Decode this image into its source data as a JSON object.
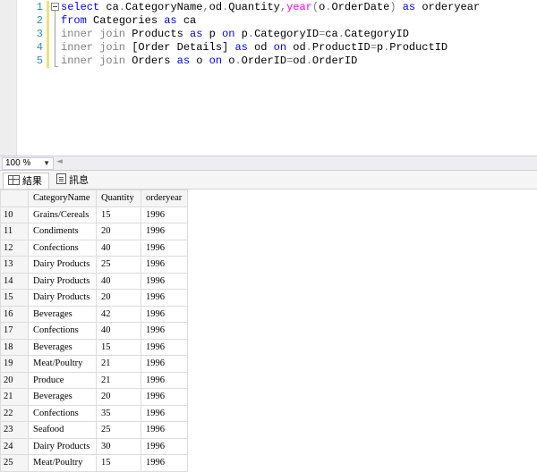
{
  "editor": {
    "line_numbers": [
      "1",
      "2",
      "3",
      "4",
      "5"
    ],
    "lines": [
      [
        {
          "t": "select",
          "c": "kw"
        },
        {
          "t": " ca",
          "c": "plain"
        },
        {
          "t": ".",
          "c": "gr"
        },
        {
          "t": "CategoryName",
          "c": "plain"
        },
        {
          "t": ",",
          "c": "gr"
        },
        {
          "t": "od",
          "c": "plain"
        },
        {
          "t": ".",
          "c": "gr"
        },
        {
          "t": "Quantity",
          "c": "plain"
        },
        {
          "t": ",",
          "c": "gr"
        },
        {
          "t": "year",
          "c": "fn"
        },
        {
          "t": "(",
          "c": "gr"
        },
        {
          "t": "o",
          "c": "plain"
        },
        {
          "t": ".",
          "c": "gr"
        },
        {
          "t": "OrderDate",
          "c": "plain"
        },
        {
          "t": ")",
          "c": "gr"
        },
        {
          "t": " as",
          "c": "kw"
        },
        {
          "t": " orderyear",
          "c": "plain"
        }
      ],
      [
        {
          "t": "from",
          "c": "kw"
        },
        {
          "t": " Categories ",
          "c": "plain"
        },
        {
          "t": "as",
          "c": "kw"
        },
        {
          "t": " ca",
          "c": "plain"
        }
      ],
      [
        {
          "t": "inner join",
          "c": "gr"
        },
        {
          "t": " Products ",
          "c": "plain"
        },
        {
          "t": "as",
          "c": "kw"
        },
        {
          "t": " p ",
          "c": "plain"
        },
        {
          "t": "on",
          "c": "kw"
        },
        {
          "t": " p",
          "c": "plain"
        },
        {
          "t": ".",
          "c": "gr"
        },
        {
          "t": "CategoryID",
          "c": "plain"
        },
        {
          "t": "=",
          "c": "gr"
        },
        {
          "t": "ca",
          "c": "plain"
        },
        {
          "t": ".",
          "c": "gr"
        },
        {
          "t": "CategoryID",
          "c": "plain"
        }
      ],
      [
        {
          "t": "inner join",
          "c": "gr"
        },
        {
          "t": " [Order Details] ",
          "c": "plain"
        },
        {
          "t": "as",
          "c": "kw"
        },
        {
          "t": " od ",
          "c": "plain"
        },
        {
          "t": "on",
          "c": "kw"
        },
        {
          "t": " od",
          "c": "plain"
        },
        {
          "t": ".",
          "c": "gr"
        },
        {
          "t": "ProductID",
          "c": "plain"
        },
        {
          "t": "=",
          "c": "gr"
        },
        {
          "t": "p",
          "c": "plain"
        },
        {
          "t": ".",
          "c": "gr"
        },
        {
          "t": "ProductID",
          "c": "plain"
        }
      ],
      [
        {
          "t": "inner join",
          "c": "gr"
        },
        {
          "t": " Orders ",
          "c": "plain"
        },
        {
          "t": "as",
          "c": "kw"
        },
        {
          "t": " o ",
          "c": "plain"
        },
        {
          "t": "on",
          "c": "kw"
        },
        {
          "t": " o",
          "c": "plain"
        },
        {
          "t": ".",
          "c": "gr"
        },
        {
          "t": "OrderID",
          "c": "plain"
        },
        {
          "t": "=",
          "c": "gr"
        },
        {
          "t": "od",
          "c": "plain"
        },
        {
          "t": ".",
          "c": "gr"
        },
        {
          "t": "OrderID",
          "c": "plain"
        }
      ]
    ]
  },
  "zoom": {
    "value": "100 %"
  },
  "tabs": {
    "results": "結果",
    "messages": "訊息"
  },
  "grid": {
    "columns": [
      "CategoryName",
      "Quantity",
      "orderyear"
    ],
    "rows": [
      {
        "n": "10",
        "cells": [
          "Grains/Cereals",
          "15",
          "1996"
        ]
      },
      {
        "n": "11",
        "cells": [
          "Condiments",
          "20",
          "1996"
        ]
      },
      {
        "n": "12",
        "cells": [
          "Confections",
          "40",
          "1996"
        ]
      },
      {
        "n": "13",
        "cells": [
          "Dairy Products",
          "25",
          "1996"
        ]
      },
      {
        "n": "14",
        "cells": [
          "Dairy Products",
          "40",
          "1996"
        ]
      },
      {
        "n": "15",
        "cells": [
          "Dairy Products",
          "20",
          "1996"
        ]
      },
      {
        "n": "16",
        "cells": [
          "Beverages",
          "42",
          "1996"
        ]
      },
      {
        "n": "17",
        "cells": [
          "Confections",
          "40",
          "1996"
        ]
      },
      {
        "n": "18",
        "cells": [
          "Beverages",
          "15",
          "1996"
        ]
      },
      {
        "n": "19",
        "cells": [
          "Meat/Poultry",
          "21",
          "1996"
        ]
      },
      {
        "n": "20",
        "cells": [
          "Produce",
          "21",
          "1996"
        ]
      },
      {
        "n": "21",
        "cells": [
          "Beverages",
          "20",
          "1996"
        ]
      },
      {
        "n": "22",
        "cells": [
          "Confections",
          "35",
          "1996"
        ]
      },
      {
        "n": "23",
        "cells": [
          "Seafood",
          "25",
          "1996"
        ]
      },
      {
        "n": "24",
        "cells": [
          "Dairy Products",
          "30",
          "1996"
        ]
      },
      {
        "n": "25",
        "cells": [
          "Meat/Poultry",
          "15",
          "1996"
        ]
      }
    ]
  }
}
